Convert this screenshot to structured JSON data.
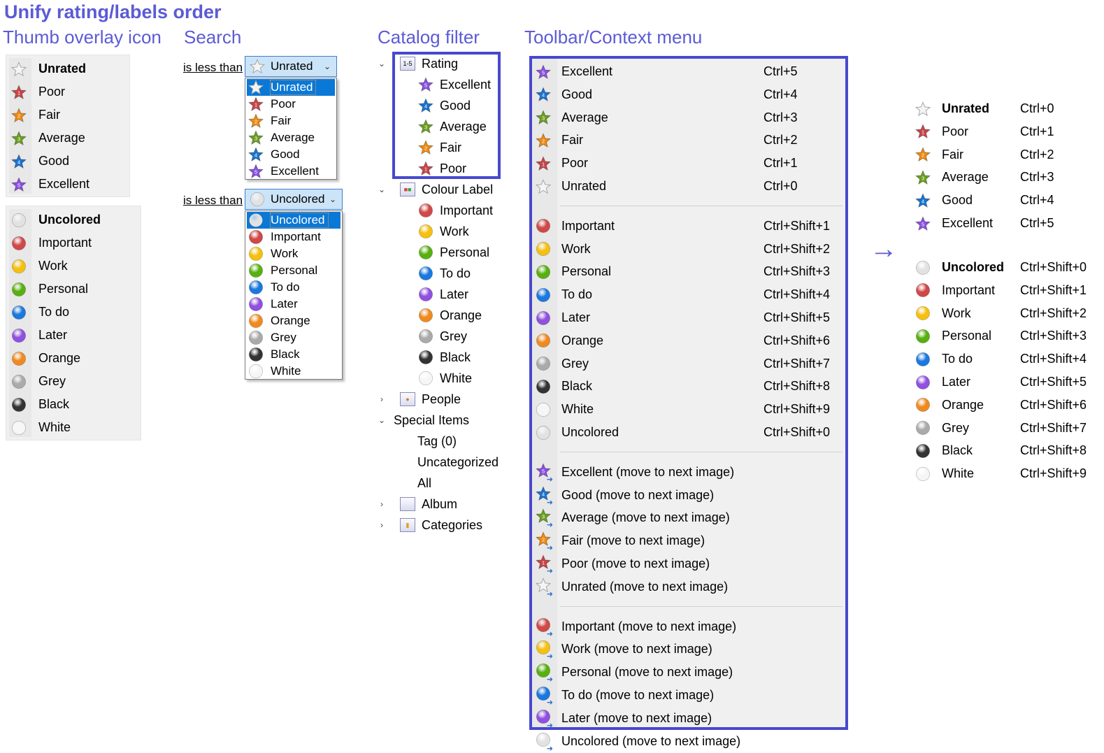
{
  "title": "Unify rating/labels order",
  "headings": {
    "thumb": "Thumb overlay icon",
    "search": "Search",
    "catalog": "Catalog filter",
    "toolbar": "Toolbar/Context menu"
  },
  "colors": {
    "heading": "#5b5bd6",
    "box": "#4848d0",
    "selection": "#0a78d7",
    "unrated": "#d8d8d8",
    "poor": "#c8454a",
    "fair": "#f08a10",
    "average": "#6aa020",
    "good": "#1a74d0",
    "excellent": "#8a50e0",
    "uncolored": "#e2e2e2",
    "important": "#d04848",
    "work": "#f5c010",
    "personal": "#58b010",
    "todo": "#1a78e0",
    "later": "#9050e0",
    "orange": "#f08a20",
    "grey": "#aaaaaa",
    "black": "#333333",
    "white": "#f6f6f6"
  },
  "thumb": {
    "ratings": [
      {
        "label": "Unrated",
        "icon": "star-unrated",
        "bold": true
      },
      {
        "label": "Poor",
        "icon": "star-poor"
      },
      {
        "label": "Fair",
        "icon": "star-fair"
      },
      {
        "label": "Average",
        "icon": "star-average"
      },
      {
        "label": "Good",
        "icon": "star-good"
      },
      {
        "label": "Excellent",
        "icon": "star-excellent"
      }
    ],
    "labels": [
      {
        "label": "Uncolored",
        "icon": "dot-uncolored",
        "bold": true
      },
      {
        "label": "Important",
        "icon": "dot-important"
      },
      {
        "label": "Work",
        "icon": "dot-work"
      },
      {
        "label": "Personal",
        "icon": "dot-personal"
      },
      {
        "label": "To do",
        "icon": "dot-todo"
      },
      {
        "label": "Later",
        "icon": "dot-later"
      },
      {
        "label": "Orange",
        "icon": "dot-orange"
      },
      {
        "label": "Grey",
        "icon": "dot-grey"
      },
      {
        "label": "Black",
        "icon": "dot-black"
      },
      {
        "label": "White",
        "icon": "dot-white"
      }
    ]
  },
  "search": {
    "rating": {
      "operator": "is less than",
      "selected": "Unrated",
      "selected_icon": "star-unrated",
      "options": [
        {
          "label": "Unrated",
          "icon": "star-unrated"
        },
        {
          "label": "Poor",
          "icon": "star-poor"
        },
        {
          "label": "Fair",
          "icon": "star-fair"
        },
        {
          "label": "Average",
          "icon": "star-average"
        },
        {
          "label": "Good",
          "icon": "star-good"
        },
        {
          "label": "Excellent",
          "icon": "star-excellent"
        }
      ]
    },
    "label": {
      "operator": "is less than",
      "selected": "Uncolored",
      "selected_icon": "dot-uncolored",
      "options": [
        {
          "label": "Uncolored",
          "icon": "dot-uncolored"
        },
        {
          "label": "Important",
          "icon": "dot-important"
        },
        {
          "label": "Work",
          "icon": "dot-work"
        },
        {
          "label": "Personal",
          "icon": "dot-personal"
        },
        {
          "label": "To do",
          "icon": "dot-todo"
        },
        {
          "label": "Later",
          "icon": "dot-later"
        },
        {
          "label": "Orange",
          "icon": "dot-orange"
        },
        {
          "label": "Grey",
          "icon": "dot-grey"
        },
        {
          "label": "Black",
          "icon": "dot-black"
        },
        {
          "label": "White",
          "icon": "dot-white"
        }
      ]
    }
  },
  "catalog": {
    "items": [
      {
        "label": "Rating",
        "icon": "folder-rating",
        "level": 0,
        "expander": "open",
        "badge": "1-5"
      },
      {
        "label": "Excellent",
        "icon": "star-excellent",
        "level": 1
      },
      {
        "label": "Good",
        "icon": "star-good",
        "level": 1
      },
      {
        "label": "Average",
        "icon": "star-average",
        "level": 1
      },
      {
        "label": "Fair",
        "icon": "star-fair",
        "level": 1
      },
      {
        "label": "Poor",
        "icon": "star-poor",
        "level": 1
      },
      {
        "label": "Colour Label",
        "icon": "folder-colour",
        "level": 0,
        "expander": "open"
      },
      {
        "label": "Important",
        "icon": "dot-important",
        "level": 1
      },
      {
        "label": "Work",
        "icon": "dot-work",
        "level": 1
      },
      {
        "label": "Personal",
        "icon": "dot-personal",
        "level": 1
      },
      {
        "label": "To do",
        "icon": "dot-todo",
        "level": 1
      },
      {
        "label": "Later",
        "icon": "dot-later",
        "level": 1
      },
      {
        "label": "Orange",
        "icon": "dot-orange",
        "level": 1
      },
      {
        "label": "Grey",
        "icon": "dot-grey",
        "level": 1
      },
      {
        "label": "Black",
        "icon": "dot-black",
        "level": 1
      },
      {
        "label": "White",
        "icon": "dot-white",
        "level": 1
      },
      {
        "label": "People",
        "icon": "folder-people",
        "level": 0,
        "expander": "closed"
      },
      {
        "label": "Special Items",
        "icon": "none",
        "level": 0,
        "expander": "open"
      },
      {
        "label": "Tag (0)",
        "icon": "none",
        "level": 2
      },
      {
        "label": "Uncategorized",
        "icon": "none",
        "level": 2
      },
      {
        "label": "All",
        "icon": "none",
        "level": 2
      },
      {
        "label": "Album",
        "icon": "folder-album",
        "level": 0,
        "expander": "closed"
      },
      {
        "label": "Categories",
        "icon": "folder-categories",
        "level": 0,
        "expander": "closed"
      }
    ]
  },
  "menu": {
    "groups": [
      [
        {
          "label": "Excellent",
          "shortcut": "Ctrl+5",
          "icon": "star-excellent"
        },
        {
          "label": "Good",
          "shortcut": "Ctrl+4",
          "icon": "star-good"
        },
        {
          "label": "Average",
          "shortcut": "Ctrl+3",
          "icon": "star-average"
        },
        {
          "label": "Fair",
          "shortcut": "Ctrl+2",
          "icon": "star-fair"
        },
        {
          "label": "Poor",
          "shortcut": "Ctrl+1",
          "icon": "star-poor"
        },
        {
          "label": "Unrated",
          "shortcut": "Ctrl+0",
          "icon": "star-unrated"
        }
      ],
      [
        {
          "label": "Important",
          "shortcut": "Ctrl+Shift+1",
          "icon": "dot-important"
        },
        {
          "label": "Work",
          "shortcut": "Ctrl+Shift+2",
          "icon": "dot-work"
        },
        {
          "label": "Personal",
          "shortcut": "Ctrl+Shift+3",
          "icon": "dot-personal"
        },
        {
          "label": "To do",
          "shortcut": "Ctrl+Shift+4",
          "icon": "dot-todo"
        },
        {
          "label": "Later",
          "shortcut": "Ctrl+Shift+5",
          "icon": "dot-later"
        },
        {
          "label": "Orange",
          "shortcut": "Ctrl+Shift+6",
          "icon": "dot-orange"
        },
        {
          "label": "Grey",
          "shortcut": "Ctrl+Shift+7",
          "icon": "dot-grey"
        },
        {
          "label": "Black",
          "shortcut": "Ctrl+Shift+8",
          "icon": "dot-black"
        },
        {
          "label": "White",
          "shortcut": "Ctrl+Shift+9",
          "icon": "dot-white"
        },
        {
          "label": "Uncolored",
          "shortcut": "Ctrl+Shift+0",
          "icon": "dot-uncolored"
        }
      ],
      [
        {
          "label": "Excellent (move to next image)",
          "icon": "star-excellent",
          "next": true
        },
        {
          "label": "Good (move to next image)",
          "icon": "star-good",
          "next": true
        },
        {
          "label": "Average (move to next image)",
          "icon": "star-average",
          "next": true
        },
        {
          "label": "Fair (move to next image)",
          "icon": "star-fair",
          "next": true
        },
        {
          "label": "Poor (move to next image)",
          "icon": "star-poor",
          "next": true
        },
        {
          "label": "Unrated (move to next image)",
          "icon": "star-unrated",
          "next": true
        }
      ],
      [
        {
          "label": "Important (move to next image)",
          "icon": "dot-important",
          "next": true
        },
        {
          "label": "Work (move to next image)",
          "icon": "dot-work",
          "next": true
        },
        {
          "label": "Personal (move to next image)",
          "icon": "dot-personal",
          "next": true
        },
        {
          "label": "To do (move to next image)",
          "icon": "dot-todo",
          "next": true
        },
        {
          "label": "Later (move to next image)",
          "icon": "dot-later",
          "next": true
        },
        {
          "label": "Uncolored (move to next image)",
          "icon": "dot-uncolored",
          "next": true
        }
      ]
    ]
  },
  "result": {
    "ratings": [
      {
        "label": "Unrated",
        "shortcut": "Ctrl+0",
        "icon": "star-unrated",
        "bold": true
      },
      {
        "label": "Poor",
        "shortcut": "Ctrl+1",
        "icon": "star-poor"
      },
      {
        "label": "Fair",
        "shortcut": "Ctrl+2",
        "icon": "star-fair"
      },
      {
        "label": "Average",
        "shortcut": "Ctrl+3",
        "icon": "star-average"
      },
      {
        "label": "Good",
        "shortcut": "Ctrl+4",
        "icon": "star-good"
      },
      {
        "label": "Excellent",
        "shortcut": "Ctrl+5",
        "icon": "star-excellent"
      }
    ],
    "labels": [
      {
        "label": "Uncolored",
        "shortcut": "Ctrl+Shift+0",
        "icon": "dot-uncolored",
        "bold": true
      },
      {
        "label": "Important",
        "shortcut": "Ctrl+Shift+1",
        "icon": "dot-important"
      },
      {
        "label": "Work",
        "shortcut": "Ctrl+Shift+2",
        "icon": "dot-work"
      },
      {
        "label": "Personal",
        "shortcut": "Ctrl+Shift+3",
        "icon": "dot-personal"
      },
      {
        "label": "To do",
        "shortcut": "Ctrl+Shift+4",
        "icon": "dot-todo"
      },
      {
        "label": "Later",
        "shortcut": "Ctrl+Shift+5",
        "icon": "dot-later"
      },
      {
        "label": "Orange",
        "shortcut": "Ctrl+Shift+6",
        "icon": "dot-orange"
      },
      {
        "label": "Grey",
        "shortcut": "Ctrl+Shift+7",
        "icon": "dot-grey"
      },
      {
        "label": "Black",
        "shortcut": "Ctrl+Shift+8",
        "icon": "dot-black"
      },
      {
        "label": "White",
        "shortcut": "Ctrl+Shift+9",
        "icon": "dot-white"
      }
    ]
  }
}
